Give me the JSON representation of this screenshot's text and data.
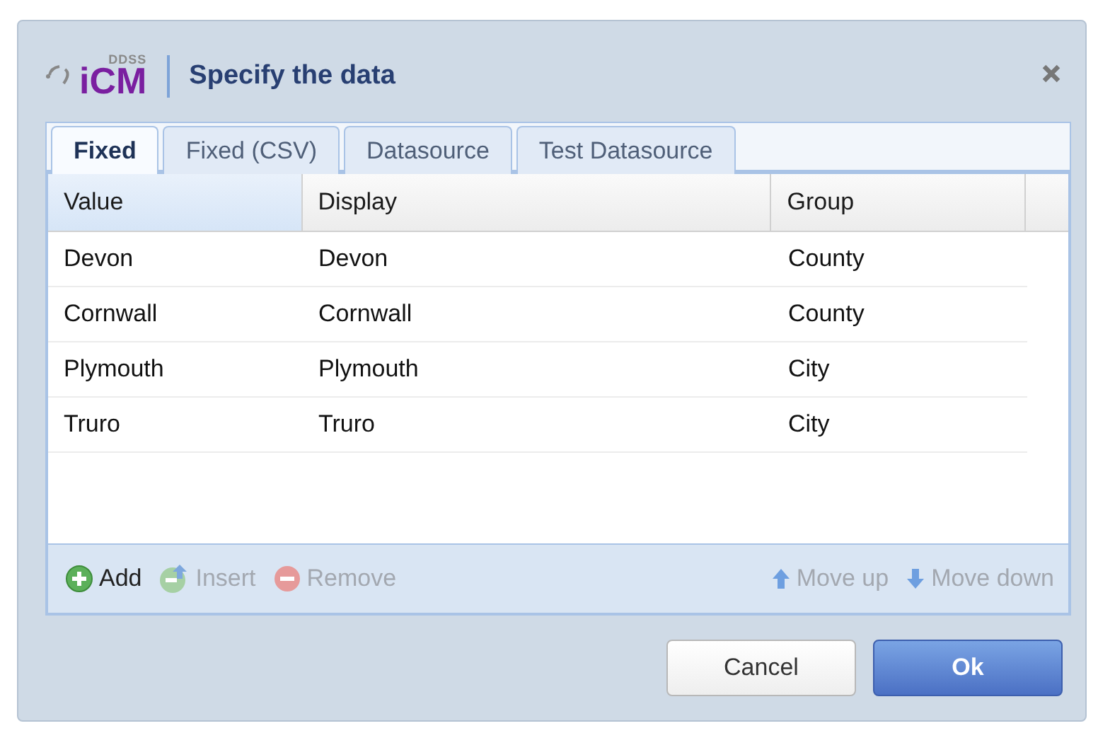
{
  "window": {
    "logo_top": "DDSS",
    "logo_main": "iCM",
    "title": "Specify the data"
  },
  "tabs": [
    {
      "label": "Fixed",
      "selected": true
    },
    {
      "label": "Fixed (CSV)",
      "selected": false
    },
    {
      "label": "Datasource",
      "selected": false
    },
    {
      "label": "Test Datasource",
      "selected": false
    }
  ],
  "table": {
    "columns": [
      {
        "label": "Value",
        "selected": true
      },
      {
        "label": "Display",
        "selected": false
      },
      {
        "label": "Group",
        "selected": false
      }
    ],
    "rows": [
      [
        "Devon",
        "Devon",
        "County"
      ],
      [
        "Cornwall",
        "Cornwall",
        "County"
      ],
      [
        "Plymouth",
        "Plymouth",
        "City"
      ],
      [
        "Truro",
        "Truro",
        "City"
      ]
    ]
  },
  "toolbar": [
    {
      "kind": "add",
      "label": "Add",
      "disabled": false
    },
    {
      "kind": "insert",
      "label": "Insert",
      "disabled": true
    },
    {
      "kind": "remove",
      "label": "Remove",
      "disabled": true
    },
    {
      "kind": "spacer"
    },
    {
      "kind": "up",
      "label": "Move up",
      "disabled": true
    },
    {
      "kind": "down",
      "label": "Move down",
      "disabled": true
    }
  ],
  "buttons": [
    {
      "label": "Cancel",
      "kind": "secondary"
    },
    {
      "label": "Ok",
      "kind": "primary"
    }
  ]
}
